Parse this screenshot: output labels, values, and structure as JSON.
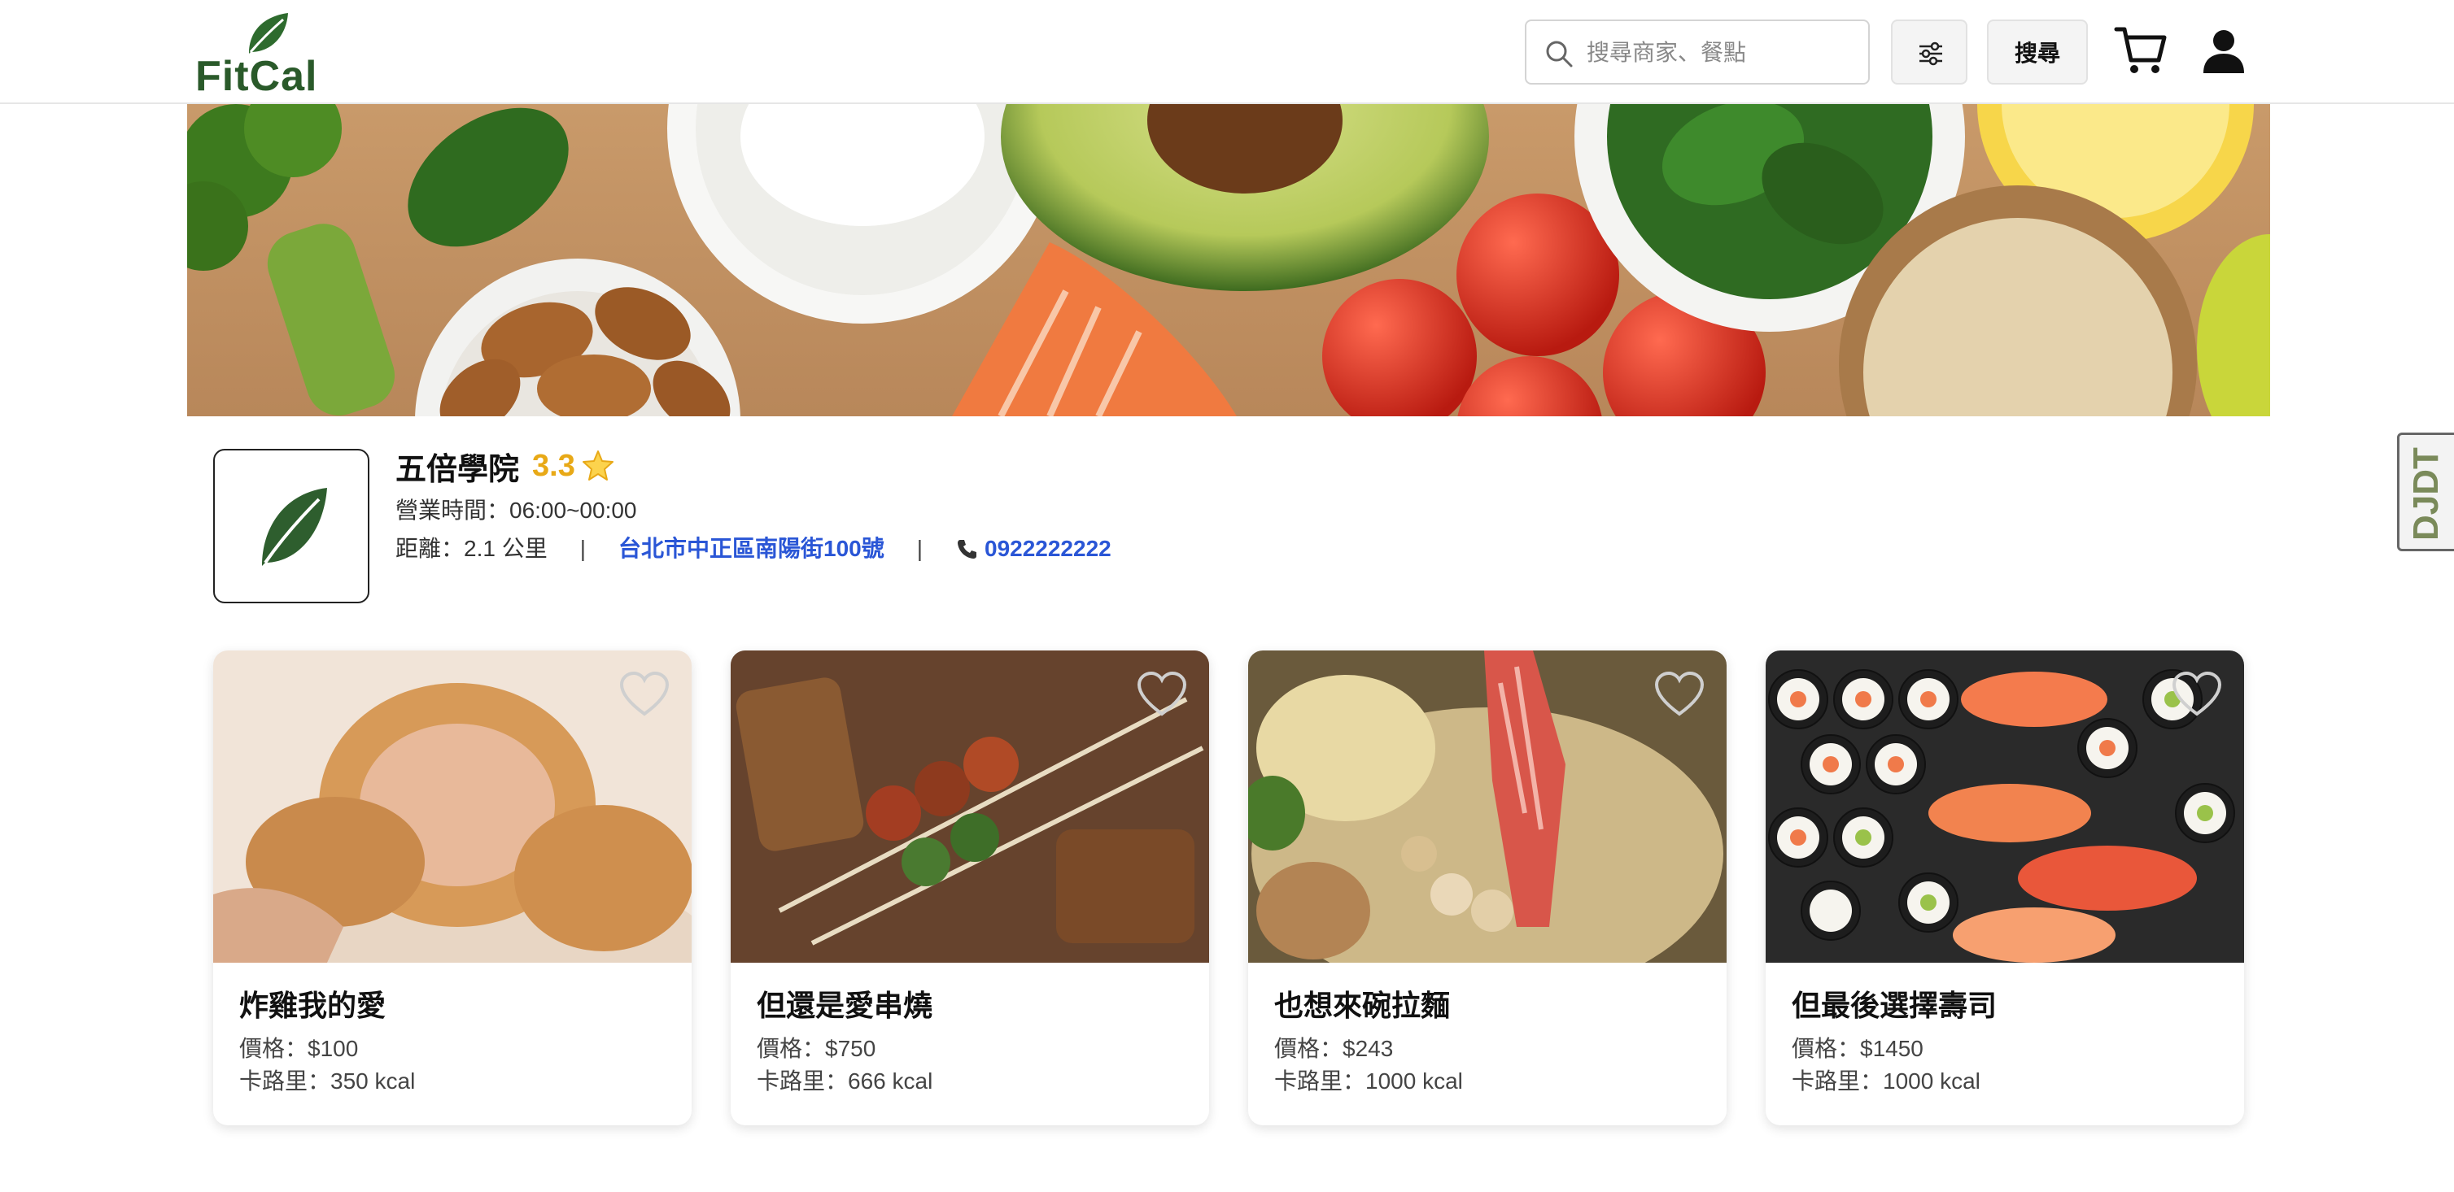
{
  "header": {
    "logo_text": "FitCal",
    "search_placeholder": "搜尋商家、餐點",
    "search_button": "搜尋",
    "icons": [
      "search-icon",
      "sliders-icon",
      "cart-icon",
      "user-icon"
    ]
  },
  "store": {
    "name": "五倍學院",
    "rating": "3.3",
    "hours": "營業時間：06:00~00:00",
    "distance": "距離：2.1 公里",
    "separator": "|",
    "address": "台北市中正區南陽街100號",
    "phone": "0922222222"
  },
  "side_widget": {
    "text": "DJDT"
  },
  "products": [
    {
      "title": "炸雞我的愛",
      "price": "價格：$100",
      "calories": "卡路里：350 kcal"
    },
    {
      "title": "但還是愛串燒",
      "price": "價格：$750",
      "calories": "卡路里：666 kcal"
    },
    {
      "title": "也想來碗拉麵",
      "price": "價格：$243",
      "calories": "卡路里：1000 kcal"
    },
    {
      "title": "但最後選擇壽司",
      "price": "價格：$1450",
      "calories": "卡路里：1000 kcal"
    }
  ],
  "colors": {
    "brand_green": "#2a5a2a",
    "rating_gold": "#e8a917",
    "link_blue": "#2a56d6"
  }
}
